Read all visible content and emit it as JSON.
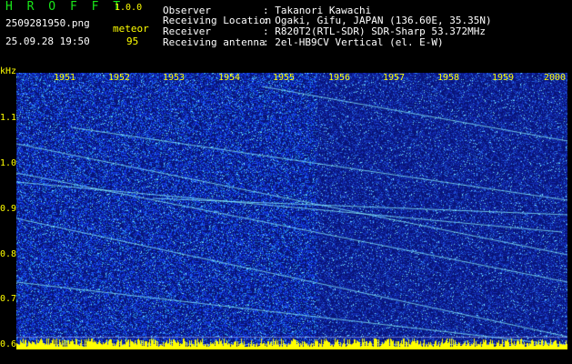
{
  "app": {
    "title": "H R O F F T",
    "version": "1.0.0"
  },
  "file": {
    "name": "2509281950.png",
    "datetime": "25.09.28 19:50"
  },
  "meteor": {
    "label": "meteor",
    "count": "95"
  },
  "info": {
    "observer_label": "Observer",
    "observer_value": ": Takanori Kawachi",
    "location_label": "Receiving Location",
    "location_value": ": Ogaki, Gifu, JAPAN (136.60E, 35.35N)",
    "receiver_label": "Receiver",
    "receiver_value": ": R820T2(RTL-SDR) SDR-Sharp 53.372MHz",
    "antenna_label": "Receiving antenna",
    "antenna_value": ": 2el-HB9CV Vertical (el. E-W)"
  },
  "axis": {
    "unit": "kHz",
    "time_ticks": [
      "1951",
      "1952",
      "1953",
      "1954",
      "1955",
      "1956",
      "1957",
      "1958",
      "1959",
      "2000"
    ],
    "freq_ticks": [
      "1.1",
      "1.0",
      "0.9",
      "0.8",
      "0.7",
      "0.6"
    ]
  },
  "colors": {
    "background": "#000000",
    "spectrogram_base": "#0a1a8c",
    "text_white": "#ffffff",
    "text_yellow": "#ffff00",
    "title_green": "#19e619",
    "echo_cyan": "#7ff5ff",
    "baseline_bar": "#ffff00"
  }
}
